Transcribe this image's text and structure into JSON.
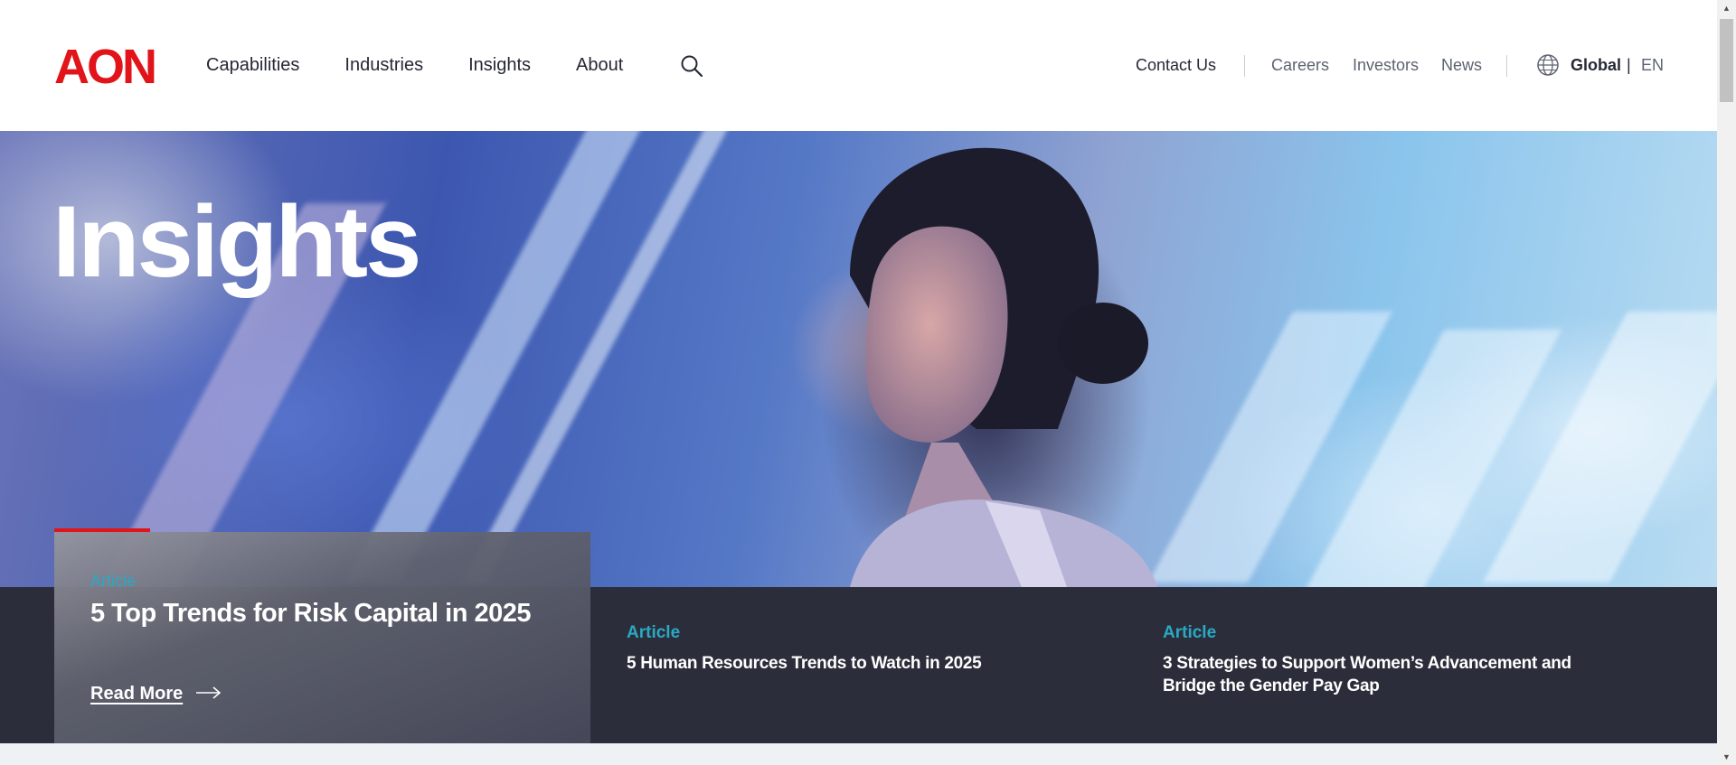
{
  "header": {
    "logo_text": "AON",
    "nav": [
      "Capabilities",
      "Industries",
      "Insights",
      "About"
    ],
    "search_icon": "search-icon",
    "contact": "Contact Us",
    "secondary_links": [
      "Careers",
      "Investors",
      "News"
    ],
    "globe_icon": "globe-icon",
    "region": "Global",
    "separator": "|",
    "language": "EN"
  },
  "hero": {
    "title": "Insights"
  },
  "featured": {
    "tag": "Article",
    "title": "5 Top Trends for Risk Capital in 2025",
    "cta": "Read More",
    "cta_icon": "arrow-right-icon"
  },
  "cards": [
    {
      "tag": "Article",
      "title": "5 Human Resources Trends to Watch in 2025"
    },
    {
      "tag": "Article",
      "title": "3 Strategies to Support Women’s Advancement and Bridge the Gender Pay Gap"
    }
  ],
  "colors": {
    "brand_red": "#e1141a",
    "accent_teal": "#2aa9c4",
    "dark_band": "#2b2e3a",
    "text_dark": "#262836"
  }
}
